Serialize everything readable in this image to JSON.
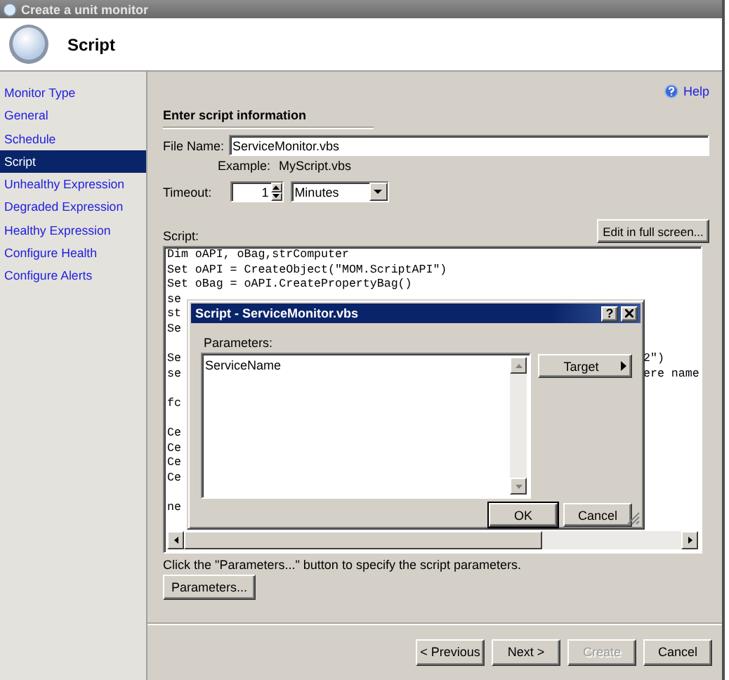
{
  "window": {
    "title": "Create a unit monitor"
  },
  "header": {
    "title": "Script"
  },
  "sidebar": {
    "items": [
      {
        "label": "Monitor Type",
        "selected": false
      },
      {
        "label": "General",
        "selected": false
      },
      {
        "label": "Schedule",
        "selected": false
      },
      {
        "label": "Script",
        "selected": true
      },
      {
        "label": "Unhealthy Expression",
        "selected": false
      },
      {
        "label": "Degraded Expression",
        "selected": false
      },
      {
        "label": "Healthy Expression",
        "selected": false
      },
      {
        "label": "Configure Health",
        "selected": false
      },
      {
        "label": "Configure Alerts",
        "selected": false
      }
    ]
  },
  "help_link": "Help",
  "section_title": "Enter script information",
  "file_name": {
    "label": "File Name:",
    "value": "ServiceMonitor.vbs",
    "example_label": "Example:",
    "example_value": "MyScript.vbs"
  },
  "timeout": {
    "label": "Timeout:",
    "value": "1",
    "unit": "Minutes"
  },
  "edit_full_screen_button": "Edit in full screen...",
  "script": {
    "label": "Script:",
    "lines": [
      {
        "kind": "text",
        "text": "Dim oAPI, oBag,strComputer"
      },
      {
        "kind": "text",
        "text": "Set oAPI = CreateObject(\"MOM.ScriptAPI\")"
      },
      {
        "kind": "text",
        "text": "Set oBag = oAPI.CreatePropertyBag()"
      },
      {
        "kind": "text",
        "text": "se"
      },
      {
        "kind": "text",
        "text": "st"
      },
      {
        "kind": "text",
        "text": "Se"
      },
      {
        "kind": "blank"
      },
      {
        "kind": "split",
        "start": "Se",
        "end": "2\")"
      },
      {
        "kind": "split",
        "start": "se",
        "end": "ere name"
      },
      {
        "kind": "blank"
      },
      {
        "kind": "text",
        "text": "fc"
      },
      {
        "kind": "blank"
      },
      {
        "kind": "text",
        "text": "Ce"
      },
      {
        "kind": "text",
        "text": "Ce"
      },
      {
        "kind": "text",
        "text": "Ce"
      },
      {
        "kind": "text",
        "text": "Ce"
      },
      {
        "kind": "blank"
      },
      {
        "kind": "text",
        "text": "ne"
      }
    ]
  },
  "dialog": {
    "title": "Script - ServiceMonitor.vbs",
    "help_button": "?",
    "parameters_label": "Parameters:",
    "parameters_value": "ServiceName",
    "target_button": "Target",
    "ok_button": "OK",
    "cancel_button": "Cancel"
  },
  "hint": "Click the \"Parameters...\" button to specify the script parameters.",
  "parameters_button": "Parameters...",
  "footer_buttons": [
    {
      "label": "< Previous",
      "disabled": false
    },
    {
      "label": "Next >",
      "disabled": false
    },
    {
      "label": "Create",
      "disabled": true
    },
    {
      "label": "Cancel",
      "disabled": false
    }
  ]
}
